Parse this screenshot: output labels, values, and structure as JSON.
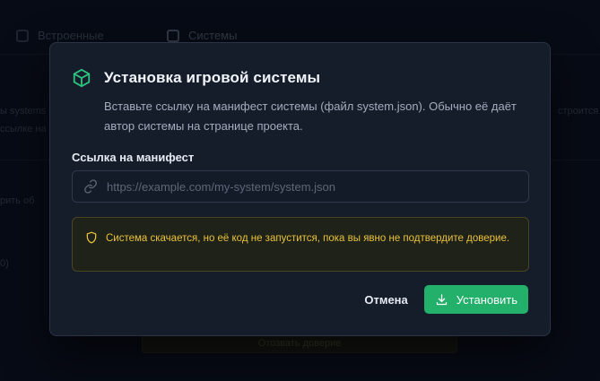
{
  "background": {
    "tabs": [
      {
        "label": "Встроенные"
      },
      {
        "label": "Системы"
      }
    ],
    "fragments": [
      "ы systems",
      "ссылке на",
      "рить об",
      "0)",
      "строится в"
    ],
    "trust_button_label": "Отозвать доверие"
  },
  "modal": {
    "title": "Установка игровой системы",
    "description": "Вставьте ссылку на манифест системы (файл system.json). Обычно её даёт автор системы на странице проекта.",
    "field_label": "Ссылка на манифест",
    "manifest_input": {
      "value": "",
      "placeholder": "https://example.com/my-system/system.json"
    },
    "warning": "Система скачается, но её код не запустится, пока вы явно не подтвердите доверие.",
    "cancel_label": "Отмена",
    "install_label": "Установить"
  },
  "colors": {
    "accent": "#22b06a",
    "warning_text": "#e9c23a",
    "warning_border": "#4a4423",
    "modal_bg": "#151d2b"
  },
  "icons": {
    "title": "cube-icon",
    "input": "link-icon",
    "warning": "shield-icon",
    "install": "download-icon"
  }
}
